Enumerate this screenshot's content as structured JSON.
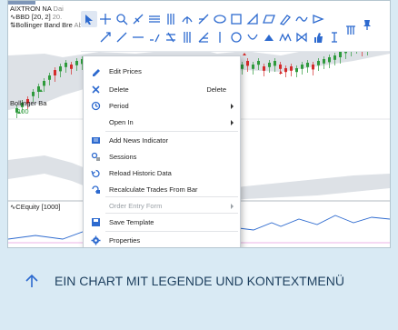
{
  "colors": {
    "page_background": "#d9eaf4",
    "accent_blue": "#2d6acf",
    "up_candle": "#2e9a3c",
    "down_candle": "#d42b2b",
    "band_fill": "#dde1e6",
    "caption_text": "#1d3f5e"
  },
  "chart": {
    "legend_main": "AIXTRON NA",
    "legend_main_suffix": "Dai",
    "legend_bb": "BBD",
    "legend_bb_params": "[20, 2]",
    "legend_bb_value": "20.",
    "legend_bb_name": "Bollinger Band Bre",
    "legend_bb_more": "Ab",
    "indicator_label": "Bollinger Ba",
    "indicator_value": "100",
    "equity_label": "CEquity",
    "equity_param": "[1000]"
  },
  "toolbar": {
    "tools": [
      "pointer-arrow-icon",
      "crosshair-icon",
      "zoom-icon",
      "measure-icon",
      "horizontal-lines-icon",
      "vertical-lines-icon",
      "channel-icon",
      "fibonacci-icon",
      "ellipse-icon",
      "rectangle-icon",
      "triangle-icon",
      "parallelogram-icon",
      "brush-icon",
      "wave-icon",
      "arrow-shape-icon",
      "ray-icon",
      "line-icon",
      "trendline-icon",
      "angle-icon",
      "regression-icon",
      "grid-icon",
      "gann-icon",
      "vertical-line-icon",
      "circle-icon",
      "arc-icon",
      "peak-icon",
      "zigzag-icon",
      "bowtie-icon",
      "thumbs-up-icon",
      "price-marker-icon",
      "pitchfork-icon",
      "pin-icon"
    ]
  },
  "menu": {
    "items": [
      {
        "icon": "pencil-icon",
        "label": "Edit Prices",
        "shortcut": "",
        "submenu": false,
        "disabled": false
      },
      {
        "icon": "close-icon",
        "label": "Delete",
        "shortcut": "Delete",
        "submenu": false,
        "disabled": false
      },
      {
        "icon": "period-icon",
        "label": "Period",
        "shortcut": "",
        "submenu": true,
        "disabled": false
      },
      {
        "icon": "",
        "label": "Open In",
        "shortcut": "",
        "submenu": true,
        "disabled": false
      },
      {
        "icon": "news-icon",
        "label": "Add News Indicator",
        "shortcut": "",
        "submenu": false,
        "disabled": false
      },
      {
        "icon": "sessions-icon",
        "label": "Sessions",
        "shortcut": "",
        "submenu": false,
        "disabled": false
      },
      {
        "icon": "reload-icon",
        "label": "Reload Historic Data",
        "shortcut": "",
        "submenu": false,
        "disabled": false
      },
      {
        "icon": "recalculate-icon",
        "label": "Recalculate Trades From Bar",
        "shortcut": "",
        "submenu": false,
        "disabled": false
      },
      {
        "icon": "",
        "label": "Order Entry Form",
        "shortcut": "",
        "submenu": true,
        "disabled": true
      },
      {
        "icon": "save-template-icon",
        "label": "Save Template",
        "shortcut": "",
        "submenu": false,
        "disabled": false
      },
      {
        "icon": "gear-icon",
        "label": "Properties",
        "shortcut": "",
        "submenu": false,
        "disabled": false
      }
    ]
  },
  "caption": {
    "arrow_icon": "arrow-up-icon",
    "text": "EIN CHART MIT LEGENDE UND KONTEXTMENÜ"
  }
}
